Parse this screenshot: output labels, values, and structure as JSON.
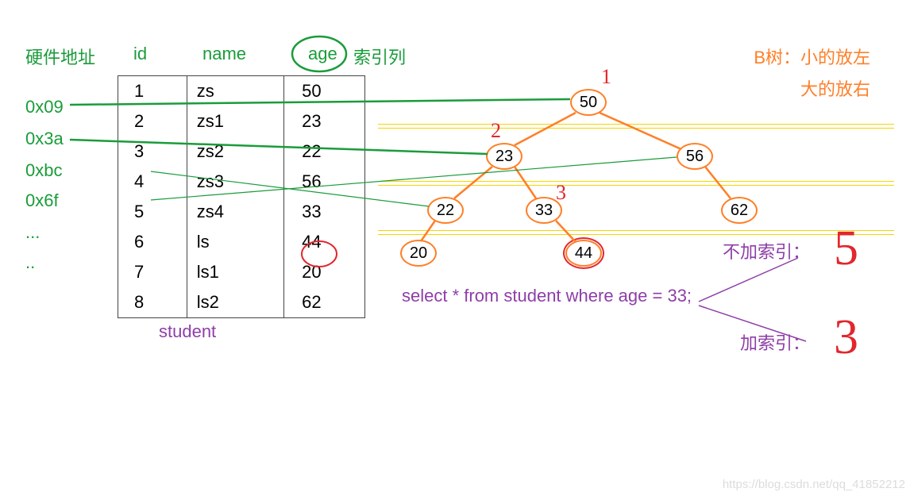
{
  "labels": {
    "hw_addr": "硬件地址",
    "index_col": "索引列",
    "btree_title": "B树：小的放左",
    "btree_sub": "大的放右",
    "no_index": "不加索引：",
    "with_index": "加索引：",
    "sql": "select * from student where age = 33;",
    "table_name": "student",
    "watermark": "https://blog.csdn.net/qq_41852212"
  },
  "headers": {
    "id": "id",
    "name": "name",
    "age": "age"
  },
  "addresses": [
    "0x09",
    "0x3a",
    "0xbc",
    "0x6f",
    "...",
    ".."
  ],
  "rows": [
    {
      "id": "1",
      "name": "zs",
      "age": "50"
    },
    {
      "id": "2",
      "name": "zs1",
      "age": "23"
    },
    {
      "id": "3",
      "name": "zs2",
      "age": "22"
    },
    {
      "id": "4",
      "name": "zs3",
      "age": "56"
    },
    {
      "id": "5",
      "name": "zs4",
      "age": "33"
    },
    {
      "id": "6",
      "name": "ls",
      "age": "44"
    },
    {
      "id": "7",
      "name": "ls1",
      "age": "20"
    },
    {
      "id": "8",
      "name": "ls2",
      "age": "62"
    }
  ],
  "tree": {
    "n50": "50",
    "n23": "23",
    "n56": "56",
    "n22": "22",
    "n33": "33",
    "n62": "62",
    "n20": "20",
    "n44": "44"
  },
  "hand": {
    "n1": "1",
    "n2": "2",
    "n3": "3",
    "five": "5",
    "three": "3"
  },
  "chart_data": {
    "type": "table",
    "title": "student table with B-tree index on age",
    "columns": [
      "hardware_address",
      "id",
      "name",
      "age"
    ],
    "rows": [
      [
        "0x09",
        1,
        "zs",
        50
      ],
      [
        "0x3a",
        2,
        "zs1",
        23
      ],
      [
        "0xbc",
        3,
        "zs2",
        22
      ],
      [
        "0x6f",
        4,
        "zs3",
        56
      ],
      [
        null,
        5,
        "zs4",
        33
      ],
      [
        null,
        6,
        "ls",
        44
      ],
      [
        null,
        7,
        "ls1",
        20
      ],
      [
        null,
        8,
        "ls2",
        62
      ]
    ],
    "btree_index_on": "age",
    "btree_structure": {
      "value": 50,
      "left": {
        "value": 23,
        "left": {
          "value": 22,
          "left": {
            "value": 20
          }
        },
        "right": {
          "value": 33,
          "right": {
            "value": 44
          }
        }
      },
      "right": {
        "value": 56,
        "right": {
          "value": 62
        }
      }
    },
    "query": "select * from student where age = 33;",
    "comparisons_without_index": 5,
    "comparisons_with_index": 3
  }
}
